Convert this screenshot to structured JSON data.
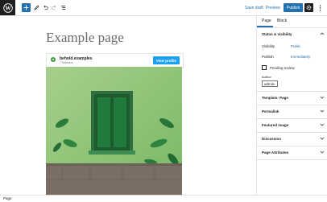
{
  "toolbar": {
    "save_draft": "Save draft",
    "preview": "Preview",
    "publish": "Publish"
  },
  "canvas": {
    "page_title": "Example page",
    "embed": {
      "name": "behold.examples",
      "followers": "7 followers",
      "button": "View profile"
    }
  },
  "sidebar": {
    "tabs": [
      "Page",
      "Block"
    ],
    "active_tab": "Page",
    "status_panel": {
      "title": "Status & visibility",
      "visibility_label": "Visibility",
      "visibility_value": "Public",
      "publish_label": "Publish",
      "publish_value": "Immediately",
      "pending_review": "Pending review",
      "author_label": "Author",
      "author_value": "admin"
    },
    "panels": [
      "Template: Page",
      "Permalink",
      "Featured image",
      "Discussion",
      "Page Attributes"
    ]
  },
  "statusbar": {
    "text": "Page"
  },
  "colors": {
    "accent": "#2271b1",
    "dark": "#1e1e1e",
    "embed_button": "#1ea0f0"
  }
}
